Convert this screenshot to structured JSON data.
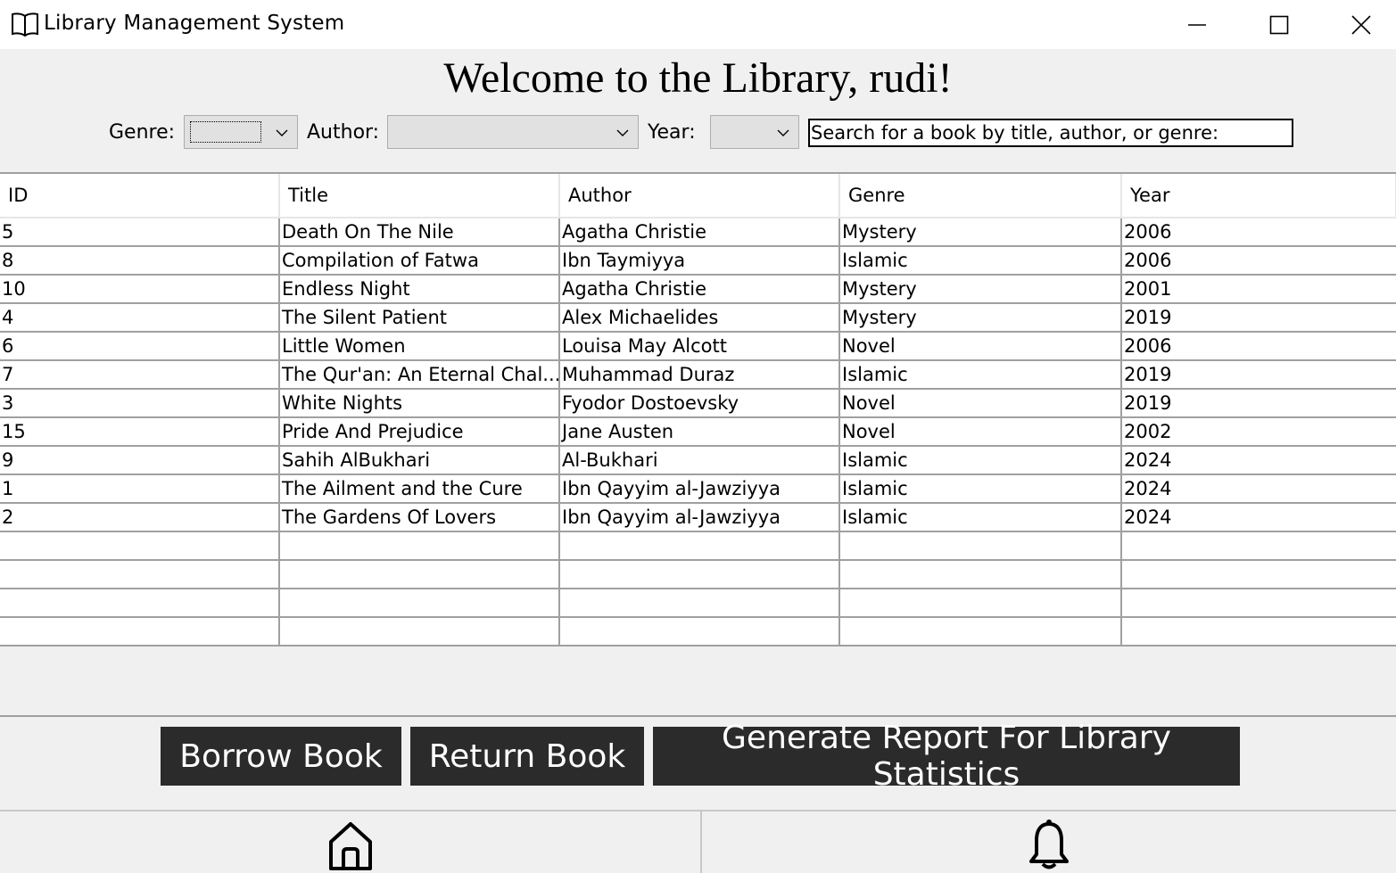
{
  "window": {
    "title": "Library Management System",
    "icons": [
      "book-icon",
      "minimize-icon",
      "maximize-icon",
      "close-icon"
    ]
  },
  "header": {
    "welcome": "Welcome to the Library, rudi!"
  },
  "filters": {
    "genre_label": "Genre:",
    "genre_value": "",
    "author_label": "Author:",
    "author_value": "",
    "year_label": "Year:",
    "year_value": "",
    "search_value": "Search for a book by title, author, or genre:"
  },
  "table": {
    "columns": [
      "ID",
      "Title",
      "Author",
      "Genre",
      "Year"
    ],
    "rows": [
      [
        "5",
        "Death On The Nile",
        "Agatha Christie",
        "Mystery",
        "2006"
      ],
      [
        "8",
        "Compilation of Fatwa",
        "Ibn Taymiyya",
        "Islamic",
        "2006"
      ],
      [
        "10",
        "Endless Night",
        "Agatha Christie",
        "Mystery",
        "2001"
      ],
      [
        "4",
        "The Silent Patient",
        "Alex Michaelides",
        "Mystery",
        "2019"
      ],
      [
        "6",
        "Little Women",
        "Louisa May Alcott",
        "Novel",
        "2006"
      ],
      [
        "7",
        "The Qur'an: An Eternal Chal...",
        "Muhammad Duraz",
        "Islamic",
        "2019"
      ],
      [
        "3",
        "White Nights",
        "Fyodor Dostoevsky",
        "Novel",
        "2019"
      ],
      [
        "15",
        "Pride And Prejudice",
        "Jane Austen",
        "Novel",
        "2002"
      ],
      [
        "9",
        "Sahih AlBukhari",
        "Al-Bukhari",
        "Islamic",
        "2024"
      ],
      [
        "1",
        "The Ailment and the Cure",
        "Ibn Qayyim al-Jawziyya",
        "Islamic",
        "2024"
      ],
      [
        "2",
        "The Gardens Of Lovers",
        "Ibn Qayyim al-Jawziyya",
        "Islamic",
        "2024"
      ],
      [
        "",
        "",
        "",
        "",
        ""
      ],
      [
        "",
        "",
        "",
        "",
        ""
      ],
      [
        "",
        "",
        "",
        "",
        ""
      ],
      [
        "",
        "",
        "",
        "",
        ""
      ]
    ]
  },
  "actions": {
    "borrow": "Borrow Book",
    "return": "Return Book",
    "report": "Generate Report For Library Statistics"
  },
  "nav": {
    "icons": [
      "home-icon",
      "bell-icon"
    ]
  },
  "colors": {
    "button_bg": "#2b2b2b",
    "window_bg": "#f0f0f0",
    "grid_line": "#a0a0a0"
  }
}
